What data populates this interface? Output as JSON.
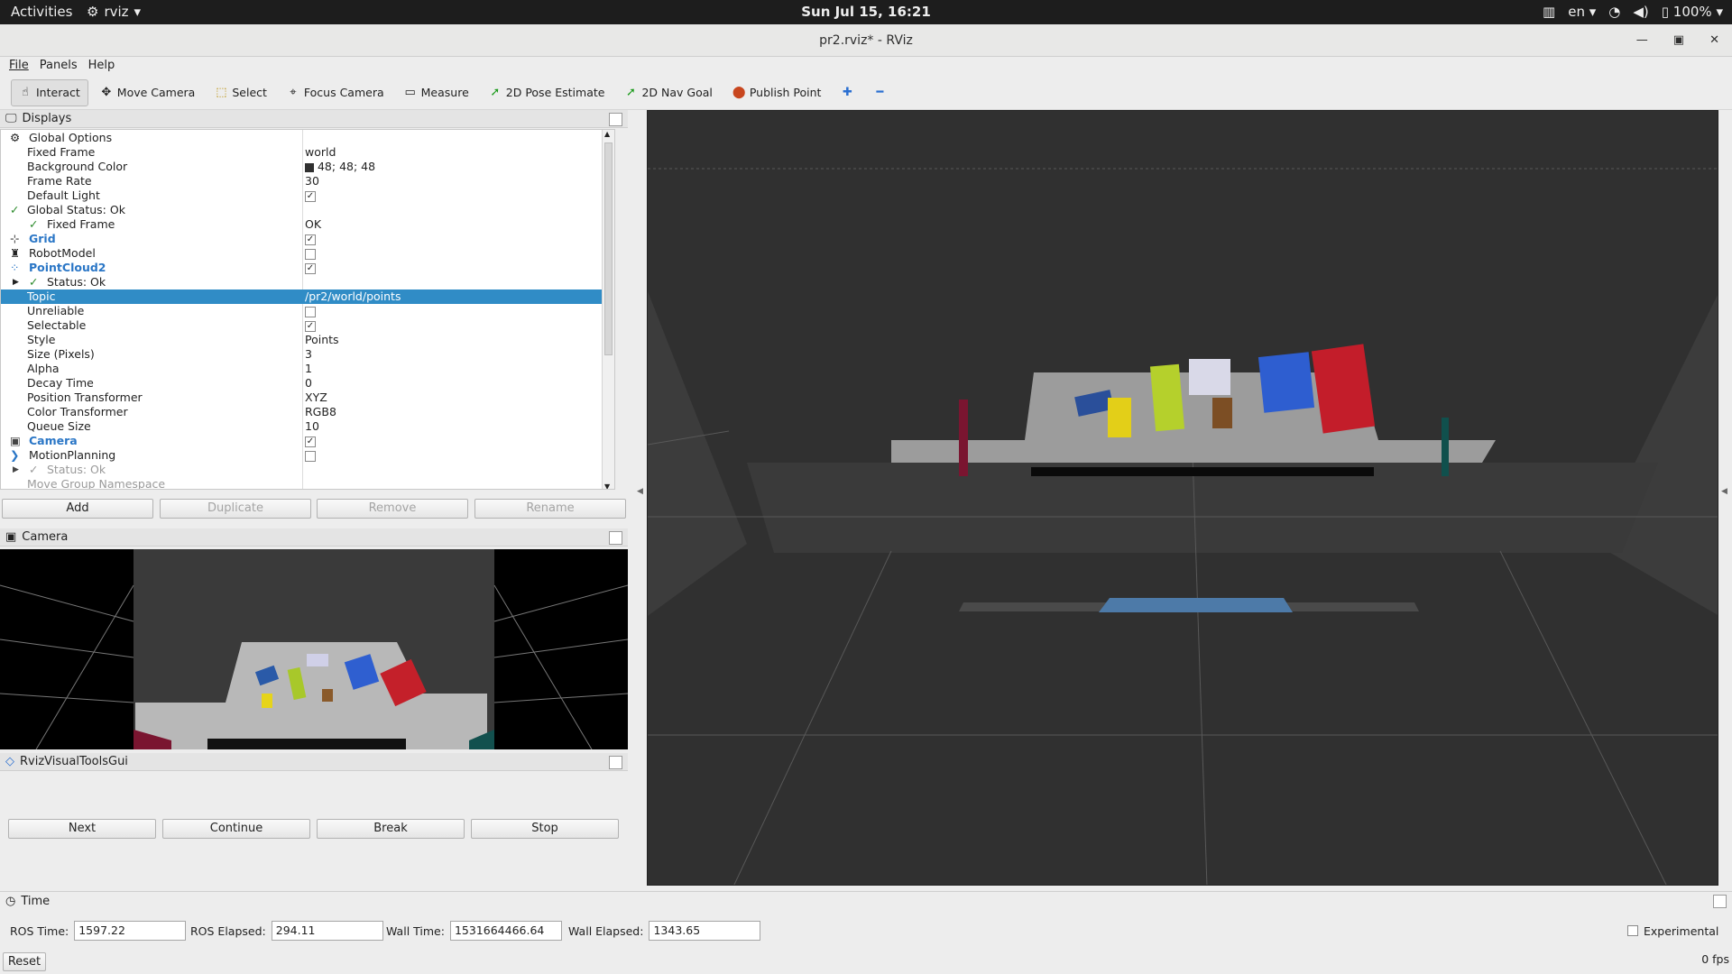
{
  "topbar": {
    "activities": "Activities",
    "app_name": "rviz",
    "clock": "Sun Jul 15, 16:21",
    "lang": "en",
    "battery": "100%"
  },
  "window": {
    "title": "pr2.rviz* - RViz"
  },
  "menu": {
    "file": "File",
    "panels": "Panels",
    "help": "Help"
  },
  "toolbar": {
    "interact": "Interact",
    "move_camera": "Move Camera",
    "select": "Select",
    "focus_camera": "Focus Camera",
    "measure": "Measure",
    "pose_estimate": "2D Pose Estimate",
    "nav_goal": "2D Nav Goal",
    "publish_point": "Publish Point"
  },
  "displays": {
    "title": "Displays",
    "rows": [
      {
        "k": "Global Options",
        "v": ""
      },
      {
        "k": "Fixed Frame",
        "v": "world"
      },
      {
        "k": "Background Color",
        "v": "48; 48; 48"
      },
      {
        "k": "Frame Rate",
        "v": "30"
      },
      {
        "k": "Default Light",
        "v": ""
      },
      {
        "k": "Global Status: Ok",
        "v": ""
      },
      {
        "k": "Fixed Frame",
        "v": "OK"
      },
      {
        "k": "Grid",
        "v": ""
      },
      {
        "k": "RobotModel",
        "v": ""
      },
      {
        "k": "PointCloud2",
        "v": ""
      },
      {
        "k": "Status: Ok",
        "v": ""
      },
      {
        "k": "Topic",
        "v": "/pr2/world/points"
      },
      {
        "k": "Unreliable",
        "v": ""
      },
      {
        "k": "Selectable",
        "v": ""
      },
      {
        "k": "Style",
        "v": "Points"
      },
      {
        "k": "Size (Pixels)",
        "v": "3"
      },
      {
        "k": "Alpha",
        "v": "1"
      },
      {
        "k": "Decay Time",
        "v": "0"
      },
      {
        "k": "Position Transformer",
        "v": "XYZ"
      },
      {
        "k": "Color Transformer",
        "v": "RGB8"
      },
      {
        "k": "Queue Size",
        "v": "10"
      },
      {
        "k": "Camera",
        "v": ""
      },
      {
        "k": "MotionPlanning",
        "v": ""
      },
      {
        "k": "Status: Ok",
        "v": ""
      },
      {
        "k": "Move Group Namespace",
        "v": ""
      }
    ],
    "buttons": {
      "add": "Add",
      "duplicate": "Duplicate",
      "remove": "Remove",
      "rename": "Rename"
    }
  },
  "camera_panel": {
    "title": "Camera"
  },
  "rvt_panel": {
    "title": "RvizVisualToolsGui",
    "next": "Next",
    "continue": "Continue",
    "break": "Break",
    "stop": "Stop"
  },
  "time_panel": {
    "title": "Time",
    "ros_time_label": "ROS Time:",
    "ros_time": "1597.22",
    "ros_elapsed_label": "ROS Elapsed:",
    "ros_elapsed": "294.11",
    "wall_time_label": "Wall Time:",
    "wall_time": "1531664466.64",
    "wall_elapsed_label": "Wall Elapsed:",
    "wall_elapsed": "1343.65",
    "experimental": "Experimental",
    "reset": "Reset",
    "fps": "0 fps"
  },
  "colors": {
    "viewport_bg": "#303030",
    "selection": "#308cc6",
    "display_name_blue": "#2a76c6"
  }
}
